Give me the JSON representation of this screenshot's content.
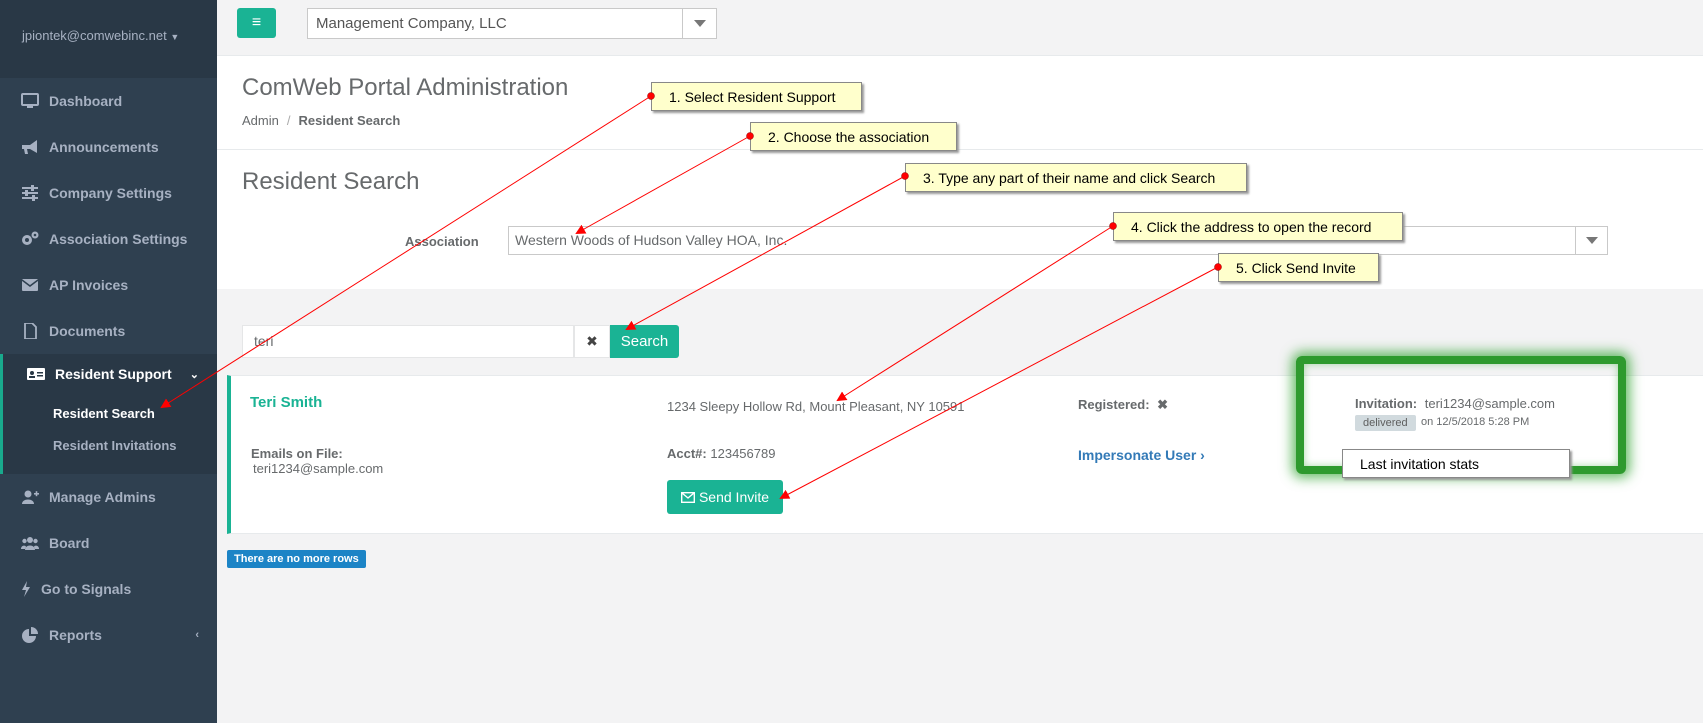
{
  "sidebar": {
    "user_email": "jpiontek@comwebinc.net",
    "items": [
      {
        "label": "Dashboard",
        "icon": "monitor-icon"
      },
      {
        "label": "Announcements",
        "icon": "bullhorn-icon"
      },
      {
        "label": "Company Settings",
        "icon": "sliders-icon"
      },
      {
        "label": "Association Settings",
        "icon": "gears-icon"
      },
      {
        "label": "AP Invoices",
        "icon": "envelope-icon"
      },
      {
        "label": "Documents",
        "icon": "file-icon"
      },
      {
        "label": "Resident Support",
        "icon": "id-card-icon"
      },
      {
        "label": "Manage Admins",
        "icon": "user-plus-icon"
      },
      {
        "label": "Board",
        "icon": "users-icon"
      },
      {
        "label": "Go to Signals",
        "icon": "bolt-icon"
      },
      {
        "label": "Reports",
        "icon": "pie-chart-icon"
      }
    ],
    "sub_items": [
      "Resident Search",
      "Resident Invitations"
    ]
  },
  "topbar": {
    "company": "Management Company, LLC"
  },
  "header": {
    "title": "ComWeb Portal Administration",
    "breadcrumb_root": "Admin",
    "breadcrumb_current": "Resident Search"
  },
  "search": {
    "title": "Resident Search",
    "association_label": "Association",
    "association_value": "Western Woods of Hudson Valley HOA, Inc.",
    "query": "teri",
    "button_label": "Search"
  },
  "result": {
    "name": "Teri Smith",
    "address": "1234 Sleepy Hollow Rd, Mount Pleasant, NY 10591",
    "registered_label": "Registered:",
    "invitation_label": "Invitation:",
    "invitation_email": "teri1234@sample.com",
    "invitation_status": "delivered",
    "invitation_date": "on 12/5/2018 5:28 PM",
    "emails_label": "Emails on File:",
    "emails_value": "teri1234@sample.com",
    "acct_label": "Acct#:",
    "acct_value": "123456789",
    "impersonate_label": "Impersonate User",
    "send_invite_label": "Send Invite"
  },
  "footer": {
    "no_more_rows": "There are no more rows"
  },
  "annotations": {
    "step1": "1. Select Resident Support",
    "step2": "2. Choose the association",
    "step3": "3. Type any part of their name and click Search",
    "step4": "4. Click the address to open the record",
    "step5": "5. Click Send Invite",
    "stats": "Last invitation stats"
  },
  "colors": {
    "sidebar_bg": "#2f4050",
    "accent": "#1ab394",
    "callout_bg": "#ffffcc",
    "highlight_green": "#2e9a2e",
    "arrow_red": "#ff0000",
    "info_blue": "#1c84c6"
  }
}
